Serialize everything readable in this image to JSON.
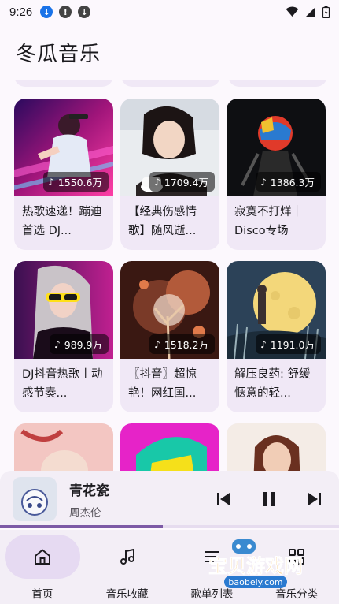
{
  "status": {
    "time": "9:26",
    "left_icons": [
      "download-icon",
      "alert-icon",
      "download-icon"
    ],
    "right_icons": [
      "wifi-icon",
      "signal-icon",
      "battery-icon"
    ]
  },
  "app": {
    "title": "冬瓜音乐"
  },
  "playlists": [
    {
      "title": "热歌速递！蹦迪首选 DJ...",
      "plays": "1550.6万",
      "cover_icon": "dj-neon-cover"
    },
    {
      "title": "【经典伤感情歌】随风逝...",
      "plays": "1709.4万",
      "cover_icon": "woman-portrait-cover"
    },
    {
      "title": "寂寞不打烊｜Disco专场",
      "plays": "1386.3万",
      "cover_icon": "disco-helmet-cover"
    },
    {
      "title": "DJ抖音热歌丨动感节奏...",
      "plays": "989.9万",
      "cover_icon": "goggles-woman-cover"
    },
    {
      "title": "〖抖音〗超惊艳！网红国...",
      "plays": "1518.2万",
      "cover_icon": "golden-tree-cover"
    },
    {
      "title": "解压良药: 舒缓惬意的轻...",
      "plays": "1191.0万",
      "cover_icon": "moon-night-cover"
    }
  ],
  "player": {
    "song": "青花瓷",
    "artist": "周杰伦",
    "progress": 0.48,
    "controls": [
      "previous-icon",
      "pause-icon",
      "next-icon"
    ]
  },
  "nav": [
    {
      "label": "首页",
      "icon": "home-icon",
      "active": true
    },
    {
      "label": "音乐收藏",
      "icon": "music-note-icon",
      "active": false
    },
    {
      "label": "歌单列表",
      "icon": "list-icon",
      "active": false
    },
    {
      "label": "音乐分类",
      "icon": "grid-icon",
      "active": false
    }
  ],
  "watermark": {
    "text": "宝贝游戏网",
    "url_text": "baobeiy.com"
  },
  "colors": {
    "accent": "#7d5aa6",
    "card_bg": "#f0e8f6",
    "nav_active": "#e6daf2"
  }
}
